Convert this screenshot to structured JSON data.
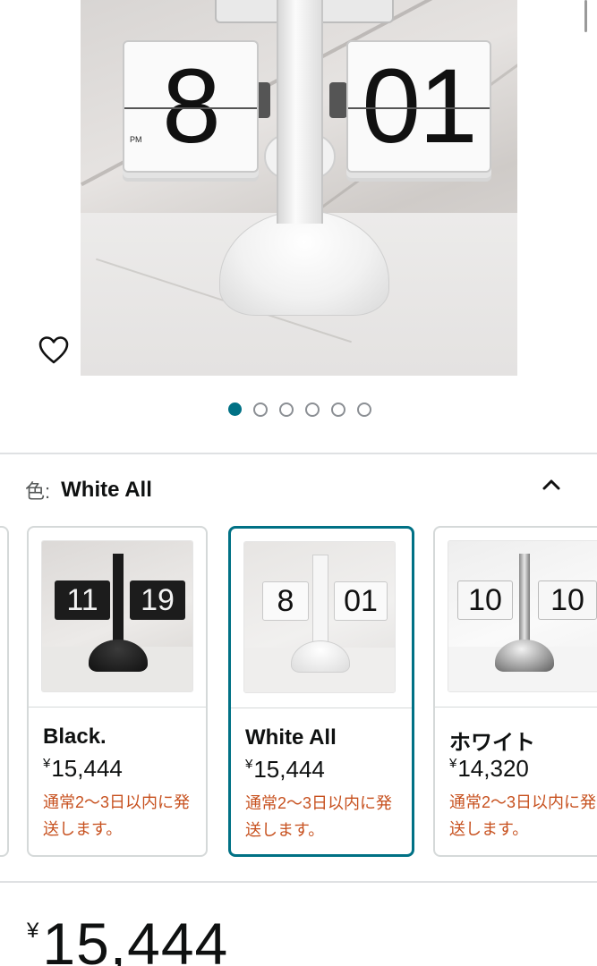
{
  "product": {
    "hero_digits_left": "8",
    "hero_digits_right": "01",
    "hero_ampm": "PM",
    "image_count": 6,
    "active_image_index": 0,
    "price_currency": "¥",
    "price": "15,444"
  },
  "color_selector": {
    "label": "色:",
    "selected": "White All"
  },
  "variants": [
    {
      "name": "",
      "price_currency": "",
      "price": "",
      "shipping": ""
    },
    {
      "name": "Black.",
      "price_currency": "¥",
      "price": "15,444",
      "shipping": "通常2～3日以内に発送します。",
      "thumb_left": "11",
      "thumb_right": "19"
    },
    {
      "name": "White All",
      "price_currency": "¥",
      "price": "15,444",
      "shipping": "通常2～3日以内に発送します。",
      "thumb_left": "8",
      "thumb_right": "01"
    },
    {
      "name": "ホワイト",
      "price_currency": "¥",
      "price": "14,320",
      "shipping": "通常2～3日以内に発送します。",
      "thumb_left": "10",
      "thumb_right": "10"
    }
  ],
  "colors": {
    "accent": "#007185",
    "shipping_text": "#c7511f",
    "dot_inactive": "#8b8f94"
  },
  "icons": {
    "favorite": "heart-icon",
    "collapse": "chevron-up-icon"
  }
}
